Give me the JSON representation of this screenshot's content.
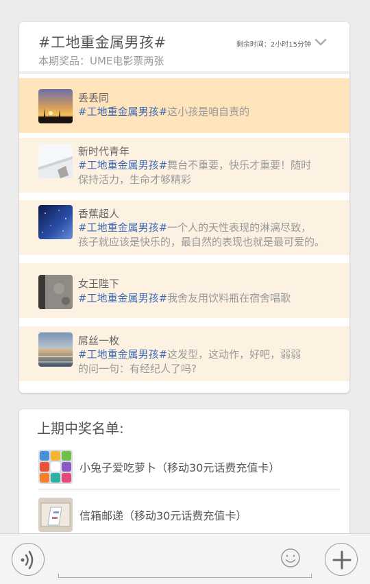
{
  "topic": {
    "title": "#工地重金属男孩#",
    "prize": "本期奖品：UME电影票两张",
    "remaining_label": "剩余时间：",
    "remaining_value": "2小时15分钟"
  },
  "entries": [
    {
      "user": "丢丢同",
      "tag": "#工地重金属男孩#",
      "text": "这小孩是咱自责的",
      "avatar_icon": "sunset-photo-avatar"
    },
    {
      "user": "新时代青年",
      "tag": "#工地重金属男孩#",
      "text": "舞台不重要，快乐才重要！随时",
      "text2": "保持活力，生命才够精彩",
      "avatar_icon": "ceiling-photo-avatar"
    },
    {
      "user": "香蕉超人",
      "tag": "#工地重金属男孩#",
      "text": "一个人的天性表现的淋漓尽致，",
      "text2": "孩子就应该是快乐的，最自然的表现也就是最可爱的。",
      "avatar_icon": "night-sky-avatar"
    },
    {
      "user": "女王陛下",
      "tag": "#工地重金属男孩#",
      "text": "我舍友用饮料瓶在宿舍唱歌",
      "avatar_icon": "concrete-wall-avatar"
    },
    {
      "user": "屌丝一枚",
      "tag": "#工地重金属男孩#",
      "text": "这发型，这动作，好吧，弱弱",
      "text2": "的问一句：有经纪人了吗?",
      "avatar_icon": "seaside-avatar"
    }
  ],
  "winners": {
    "title": "上期中奖名单:",
    "items": [
      {
        "name": "小兔子爱吃萝卜（移动30元话费充值卡）",
        "avatar_icon": "app-icons-avatar"
      },
      {
        "name": "信箱邮递（移动30元话费充值卡）",
        "avatar_icon": "envelope-avatar"
      }
    ]
  },
  "colors": {
    "highlight_row": "#ffe3bb",
    "row_bg": "#fdf2e2",
    "tag": "#3a68b5"
  }
}
